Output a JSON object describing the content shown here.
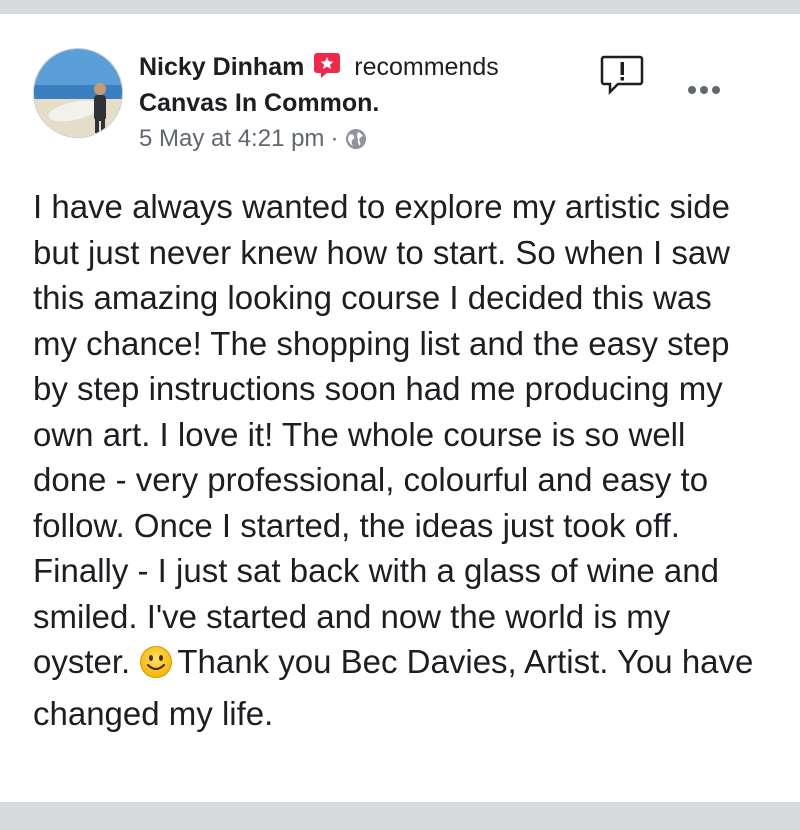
{
  "post": {
    "author": "Nicky Dinham",
    "action": "recommends",
    "page": "Canvas In Common.",
    "timestamp": "5 May at 4:21 pm",
    "separator": "·",
    "privacy_icon": "globe-icon",
    "text_part1": "I have always wanted to explore my artistic side but just never knew how to start. So when I saw this amazing looking course I decided this was my chance! The shopping list and the easy step by step instructions soon had me producing my own art. I love it! The whole course is so well done - very professional, colourful and easy to follow. Once I started, the ideas just took off. Finally - I just sat back with a glass of wine and smiled. I've started and now the world is my oyster. ",
    "text_part2": "Thank you Bec Davies, Artist. You have changed my life."
  },
  "icons": {
    "recommend": "recommend-star-icon",
    "report": "report-icon",
    "more": "more-options-icon",
    "emoji": "smiley-emoji-icon"
  },
  "colors": {
    "recommend_badge": "#f02849",
    "text": "#1c1e21",
    "meta": "#606770",
    "background": "#d9dadc"
  }
}
